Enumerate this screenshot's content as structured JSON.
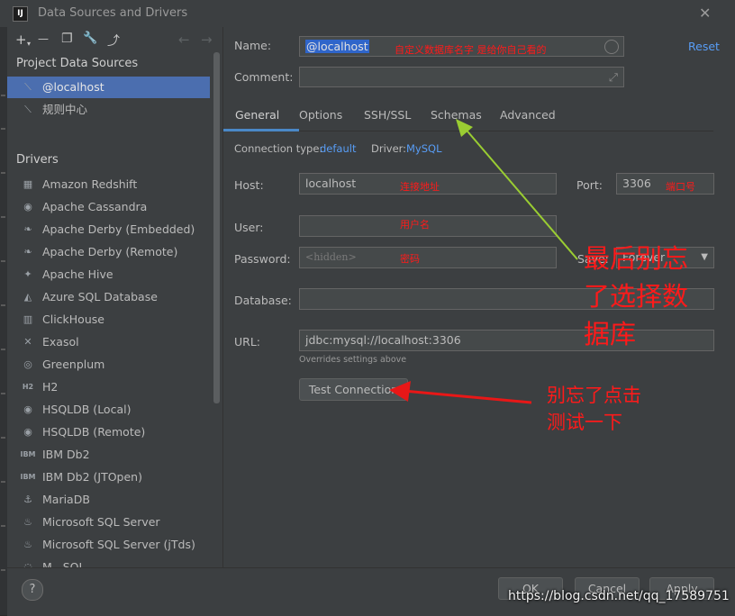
{
  "window": {
    "icon_text": "IJ",
    "title": "Data Sources and Drivers",
    "close": "✕"
  },
  "left": {
    "toolbar": {
      "add": "+",
      "add_arrow": "▾",
      "remove": "—",
      "copy": "❐",
      "settings": "🔧",
      "import": "⤴",
      "back": "←",
      "forward": "→"
    },
    "project_header": "Project Data Sources",
    "project_items": [
      {
        "label": "@localhost",
        "icon": "db-icon"
      },
      {
        "label": "规则中心",
        "icon": "db-icon"
      }
    ],
    "drivers_header": "Drivers",
    "drivers": [
      {
        "label": "Amazon Redshift",
        "icon": "redshift-icon",
        "glyph": "▦"
      },
      {
        "label": "Apache Cassandra",
        "icon": "cassandra-icon",
        "glyph": "◉"
      },
      {
        "label": "Apache Derby (Embedded)",
        "icon": "derby-icon",
        "glyph": "❧"
      },
      {
        "label": "Apache Derby (Remote)",
        "icon": "derby-icon",
        "glyph": "❧"
      },
      {
        "label": "Apache Hive",
        "icon": "hive-icon",
        "glyph": "✦"
      },
      {
        "label": "Azure SQL Database",
        "icon": "azure-icon",
        "glyph": "◭"
      },
      {
        "label": "ClickHouse",
        "icon": "clickhouse-icon",
        "glyph": "▥"
      },
      {
        "label": "Exasol",
        "icon": "exasol-icon",
        "glyph": "✕"
      },
      {
        "label": "Greenplum",
        "icon": "greenplum-icon",
        "glyph": "◎"
      },
      {
        "label": "H2",
        "icon": "h2-icon",
        "glyph": "H2"
      },
      {
        "label": "HSQLDB (Local)",
        "icon": "hsqldb-icon",
        "glyph": "◉"
      },
      {
        "label": "HSQLDB (Remote)",
        "icon": "hsqldb-icon",
        "glyph": "◉"
      },
      {
        "label": "IBM Db2",
        "icon": "db2-icon",
        "glyph": "IBM"
      },
      {
        "label": "IBM Db2 (JTOpen)",
        "icon": "db2-icon",
        "glyph": "IBM"
      },
      {
        "label": "MariaDB",
        "icon": "mariadb-icon",
        "glyph": "⚓"
      },
      {
        "label": "Microsoft SQL Server",
        "icon": "mssql-icon",
        "glyph": "♨"
      },
      {
        "label": "Microsoft SQL Server (jTds)",
        "icon": "mssql-icon",
        "glyph": "♨"
      },
      {
        "label": "M...SQL",
        "icon": "mysql-icon",
        "glyph": "◌"
      }
    ]
  },
  "form": {
    "name_label": "Name:",
    "name_value": "@localhost",
    "name_annotation": "自定义数据库名字 是给你自己看的",
    "reset": "Reset",
    "comment_label": "Comment:",
    "expand_icon": "⤢",
    "tabs": [
      "General",
      "Options",
      "SSH/SSL",
      "Schemas",
      "Advanced"
    ],
    "conn_type_label": "Connection type:",
    "conn_type_value": "default",
    "driver_label": "Driver:",
    "driver_value": "MySQL",
    "host_label": "Host:",
    "host_value": "localhost",
    "host_annotation": "连接地址",
    "port_label": "Port:",
    "port_value": "3306",
    "port_annotation": "端口号",
    "user_label": "User:",
    "user_annotation": "用户名",
    "password_label": "Password:",
    "password_placeholder": "<hidden>",
    "password_annotation": "密码",
    "save_label": "Save:",
    "save_value": "Forever",
    "database_label": "Database:",
    "url_label": "URL:",
    "url_value": "jdbc:mysql://localhost:3306",
    "url_note": "Overrides settings above",
    "test_button": "Test Connection"
  },
  "annotations": {
    "schema_note": "最后别忘了选择数据库",
    "schema_lines": [
      "最后别忘",
      "了选择数",
      "据库"
    ],
    "test_lines": [
      "别忘了点击",
      "测试一下"
    ]
  },
  "footer": {
    "help": "?",
    "ok": "OK",
    "cancel": "Cancel",
    "apply": "Apply"
  },
  "watermark": "https://blog.csdn.net/qq_17589751",
  "colors": {
    "accent": "#4b6eaf",
    "link": "#589df6",
    "annotation_red": "#ff1a1a",
    "arrow_green": "#9acd32"
  }
}
